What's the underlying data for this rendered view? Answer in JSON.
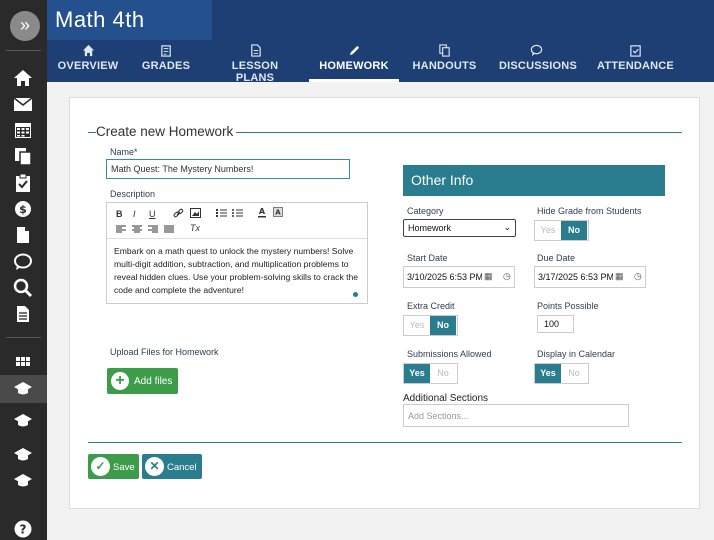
{
  "app": {
    "title": "Math 4th"
  },
  "rail": {
    "toggle_glyph": "»",
    "icons": [
      "home-icon",
      "mail-icon",
      "calendar-icon",
      "copy-icon",
      "clipboard-check-icon",
      "dollar-icon",
      "document-icon",
      "chat-icon",
      "search-icon",
      "file-icon",
      "grid-icon",
      "graduation-cap-icon",
      "graduation-cap-icon",
      "graduation-cap-icon",
      "graduation-cap-icon",
      "help-icon"
    ]
  },
  "tabs": [
    {
      "label": "OVERVIEW",
      "icon": "home-icon"
    },
    {
      "label": "GRADES",
      "icon": "grades-icon"
    },
    {
      "label": "LESSON PLANS",
      "icon": "document-icon"
    },
    {
      "label": "HOMEWORK",
      "icon": "pencil-icon",
      "active": true
    },
    {
      "label": "HANDOUTS",
      "icon": "copy-icon"
    },
    {
      "label": "DISCUSSIONS",
      "icon": "chat-icon"
    },
    {
      "label": "ATTENDANCE",
      "icon": "clipboard-check-icon"
    }
  ],
  "form": {
    "legend": "Create new Homework",
    "name_label": "Name*",
    "name_value": "Math Quest: The Mystery Numbers!",
    "description_label": "Description",
    "toolbar": {
      "bold": "B",
      "italic": "I",
      "underline": "U",
      "clear_format": "Tx"
    },
    "description_text": "Embark on a math quest to unlock the mystery numbers! Solve multi-digit addition, subtraction, and multiplication problems to reveal hidden clues. Use your problem-solving skills to crack the code and complete the adventure!",
    "upload_label": "Upload Files for Homework",
    "add_files_label": "Add files"
  },
  "other_info": {
    "heading": "Other Info",
    "category_label": "Category",
    "category_value": "Homework",
    "hide_grade_label": "Hide Grade from Students",
    "start_date_label": "Start Date",
    "start_date_value": "3/10/2025 6:53 PM",
    "due_date_label": "Due Date",
    "due_date_value": "3/17/2025 6:53 PM",
    "extra_credit_label": "Extra Credit",
    "points_label": "Points Possible",
    "points_value": "100",
    "submissions_label": "Submissions Allowed",
    "display_calendar_label": "Display in Calendar",
    "additional_sections_label": "Additional Sections",
    "sections_placeholder": "Add Sections...",
    "yes": "Yes",
    "no": "No"
  },
  "actions": {
    "save": "Save",
    "cancel": "Cancel"
  },
  "colors": {
    "header": "#1d3f73",
    "accent": "#2a7d8f",
    "success": "#3c9c4a",
    "rail": "#2a2a2a"
  }
}
